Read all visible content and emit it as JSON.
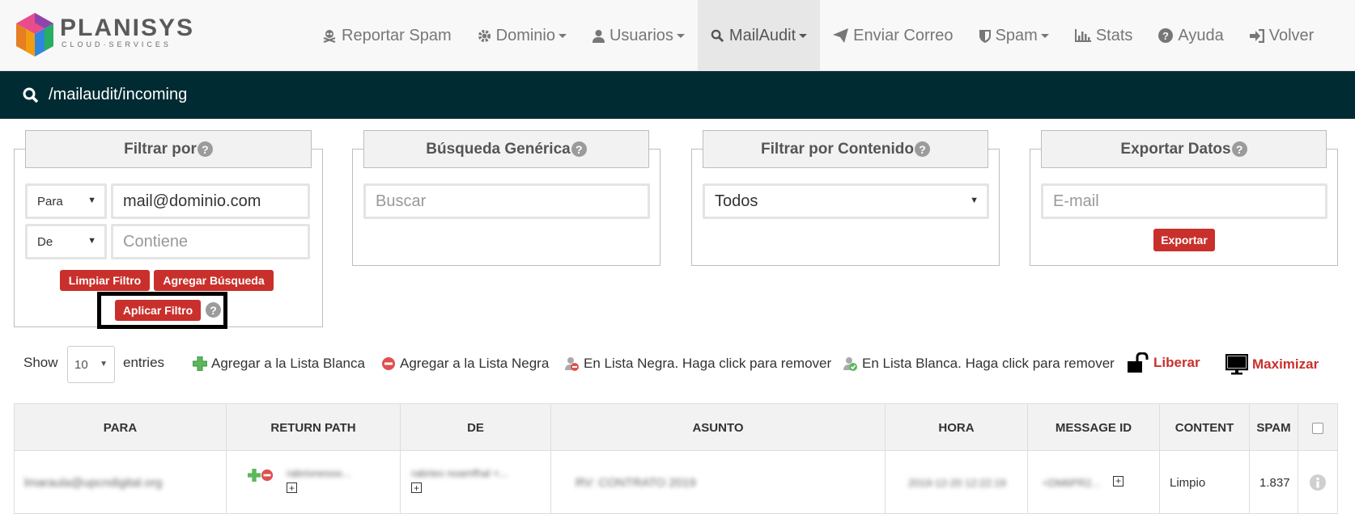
{
  "brand": {
    "name": "PLANISYS",
    "tagline": "CLOUD·SERVICES"
  },
  "nav": [
    {
      "label": "Reportar Spam",
      "icon": "skull-crossbones-icon",
      "dropdown": false,
      "active": false
    },
    {
      "label": "Dominio",
      "icon": "gear-icon",
      "dropdown": true,
      "active": false
    },
    {
      "label": "Usuarios",
      "icon": "user-icon",
      "dropdown": true,
      "active": false
    },
    {
      "label": "MailAudit",
      "icon": "search-icon",
      "dropdown": true,
      "active": true
    },
    {
      "label": "Enviar Correo",
      "icon": "paper-plane-icon",
      "dropdown": false,
      "active": false
    },
    {
      "label": "Spam",
      "icon": "shield-icon",
      "dropdown": true,
      "active": false
    },
    {
      "label": "Stats",
      "icon": "bar-chart-icon",
      "dropdown": false,
      "active": false
    },
    {
      "label": "Ayuda",
      "icon": "question-circle-icon",
      "dropdown": false,
      "active": false
    },
    {
      "label": "Volver",
      "icon": "sign-in-icon",
      "dropdown": false,
      "active": false
    }
  ],
  "path": "/mailaudit/incoming",
  "filter": {
    "title": "Filtrar por",
    "help": "?",
    "row1": {
      "select": "Para",
      "value": "mail@dominio.com"
    },
    "row2": {
      "select": "De",
      "placeholder": "Contiene"
    },
    "clear_label": "Limpiar Filtro",
    "add_label": "Agregar Búsqueda",
    "apply_label": "Aplicar Filtro"
  },
  "generic": {
    "title": "Búsqueda Genérica",
    "placeholder": "Buscar"
  },
  "content": {
    "title": "Filtrar por Contenido",
    "selected": "Todos"
  },
  "export": {
    "title": "Exportar Datos",
    "placeholder": "E-mail",
    "button": "Exportar"
  },
  "controls": {
    "show": "Show",
    "entries_value": "10",
    "entries": "entries",
    "whitelist_add": "Agregar a la Lista Blanca",
    "blacklist_add": "Agregar a la Lista Negra",
    "in_blacklist": "En Lista Negra. Haga click para remover",
    "in_whitelist": "En Lista Blanca. Haga click para remover",
    "release": "Liberar",
    "maximize": "Maximizar"
  },
  "table": {
    "headers": [
      "PARA",
      "RETURN PATH",
      "DE",
      "ASUNTO",
      "HORA",
      "MESSAGE ID",
      "CONTENT",
      "SPAM"
    ],
    "rows": [
      {
        "para": "lmaraula@upcndigital.org",
        "return_path": "rabrionesoo...",
        "de": "rabrieo noamfhal <...",
        "asunto": "RV: CONTRATO 2019",
        "hora": "2019-12-20 12:22:19",
        "message_id": "<DM6PR2...",
        "content": "Limpio",
        "spam": "1.837"
      }
    ]
  },
  "colors": {
    "accent": "#c9302c",
    "pathbar": "#012b33",
    "nav_bg": "#f8f8f8"
  }
}
